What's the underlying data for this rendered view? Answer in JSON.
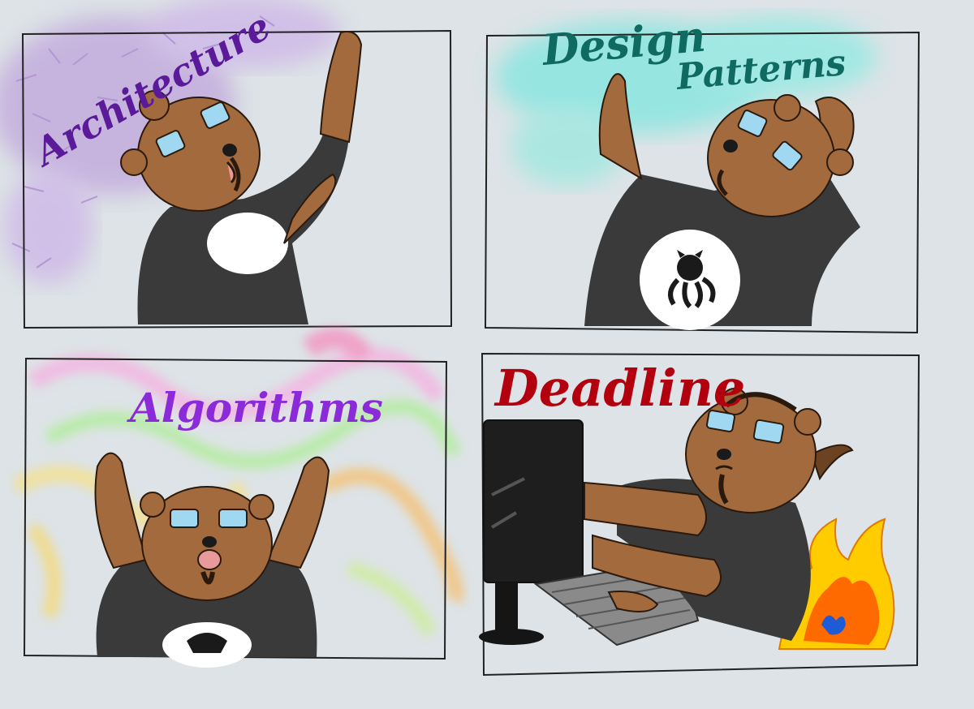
{
  "comic": {
    "panels": [
      {
        "caption": "Architecture",
        "caption_color": "#5b1a9a",
        "effect": "purple-scribbles"
      },
      {
        "caption": "Design",
        "caption2": "Patterns",
        "caption_color": "#0f6b62",
        "effect": "cyan-cloud"
      },
      {
        "caption": "Algorithms",
        "caption_color": "#8b2ad8",
        "effect": "rainbow-swirls"
      },
      {
        "caption": "Deadline",
        "caption_color": "#b3000f",
        "effect": "fire"
      }
    ],
    "colors": {
      "background": "#dde3e6",
      "fur": "#a36a3d",
      "fur_dark": "#6b4222",
      "shirt": "#3a3a3a",
      "glasses": "#9fd8f0",
      "fire_outer": "#ffcc00",
      "fire_inner": "#ff6a00",
      "fire_core": "#1e5bd6"
    }
  }
}
